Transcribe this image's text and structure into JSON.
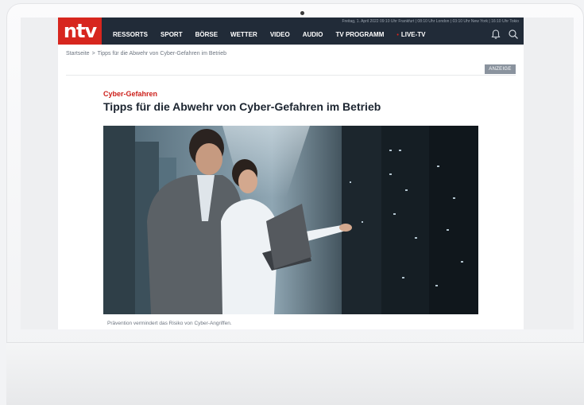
{
  "header": {
    "logo": "ntv",
    "dateline": "Freitag, 1. April 2022 09:10 Uhr Frankfurt | 08:10 Uhr London | 03:10 Uhr New York | 16:10 Uhr Tokio",
    "nav": [
      {
        "label": "RESSORTS"
      },
      {
        "label": "SPORT"
      },
      {
        "label": "BÖRSE"
      },
      {
        "label": "WETTER"
      },
      {
        "label": "VIDEO"
      },
      {
        "label": "AUDIO"
      },
      {
        "label": "TV PROGRAMM"
      },
      {
        "label": "LIVE-TV",
        "live_dot": "•"
      }
    ],
    "icons": [
      "bell-icon",
      "search-icon"
    ]
  },
  "breadcrumb": {
    "home": "Startseite",
    "separator": ">",
    "current": "Tipps für die Abwehr von Cyber-Gefahren im Betrieb"
  },
  "ad_badge": "ANZEIGE",
  "article": {
    "kicker": "Cyber-Gefahren",
    "headline": "Tipps für die Abwehr von Cyber-Gefahren im Betrieb",
    "caption": "Prävention vermindert das Risiko von Cyber-Angriffen."
  },
  "colors": {
    "brand_red": "#d7261e",
    "nav_bg": "#212b38",
    "kicker_red": "#cc1f1a",
    "ad_badge_bg": "#8a939e"
  }
}
